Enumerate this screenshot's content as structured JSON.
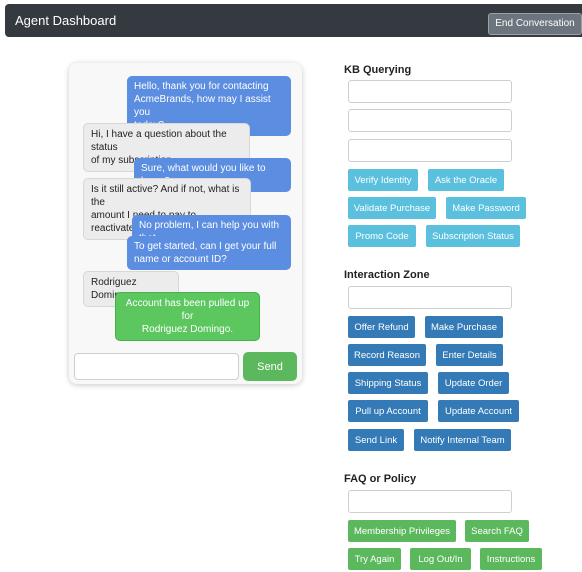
{
  "header": {
    "title": "Agent Dashboard",
    "end_button": "End Conversation"
  },
  "chat": {
    "messages": [
      {
        "role": "agent",
        "text": "Hello, thank you for contacting\nAcmeBrands, how may I assist you\ntoday?"
      },
      {
        "role": "user",
        "text": "Hi, I have a question about the status\nof my subscription."
      },
      {
        "role": "agent",
        "text": "Sure, what would you like to know?"
      },
      {
        "role": "user",
        "text": "Is it still active? And if not, what is the\namount I need to pay to reactivate?"
      },
      {
        "role": "agent",
        "text": "No problem, I can help you with that."
      },
      {
        "role": "agent",
        "text": "To get started, can I get your full\nname or account ID?"
      },
      {
        "role": "user",
        "text": "Rodriguez Domingo"
      },
      {
        "role": "system",
        "text": "Account has been pulled up for\nRodriguez Domingo."
      }
    ],
    "input_value": "",
    "send_label": "Send"
  },
  "kb": {
    "title": "KB Querying",
    "fields": [
      "",
      "",
      ""
    ],
    "buttons": [
      "Verify Identity",
      "Ask the Oracle",
      "Validate Purchase",
      "Make Password",
      "Promo Code",
      "Subscription Status"
    ]
  },
  "interaction": {
    "title": "Interaction Zone",
    "field": "",
    "buttons": [
      "Offer Refund",
      "Make Purchase",
      "Record Reason",
      "Enter Details",
      "Shipping Status",
      "Update Order",
      "Pull up Account",
      "Update Account",
      "Send Link",
      "Notify Internal Team"
    ]
  },
  "faq": {
    "title": "FAQ or Policy",
    "field": "",
    "buttons": [
      "Membership Privileges",
      "Search FAQ",
      "Try Again",
      "Log Out/In",
      "Instructions"
    ]
  }
}
